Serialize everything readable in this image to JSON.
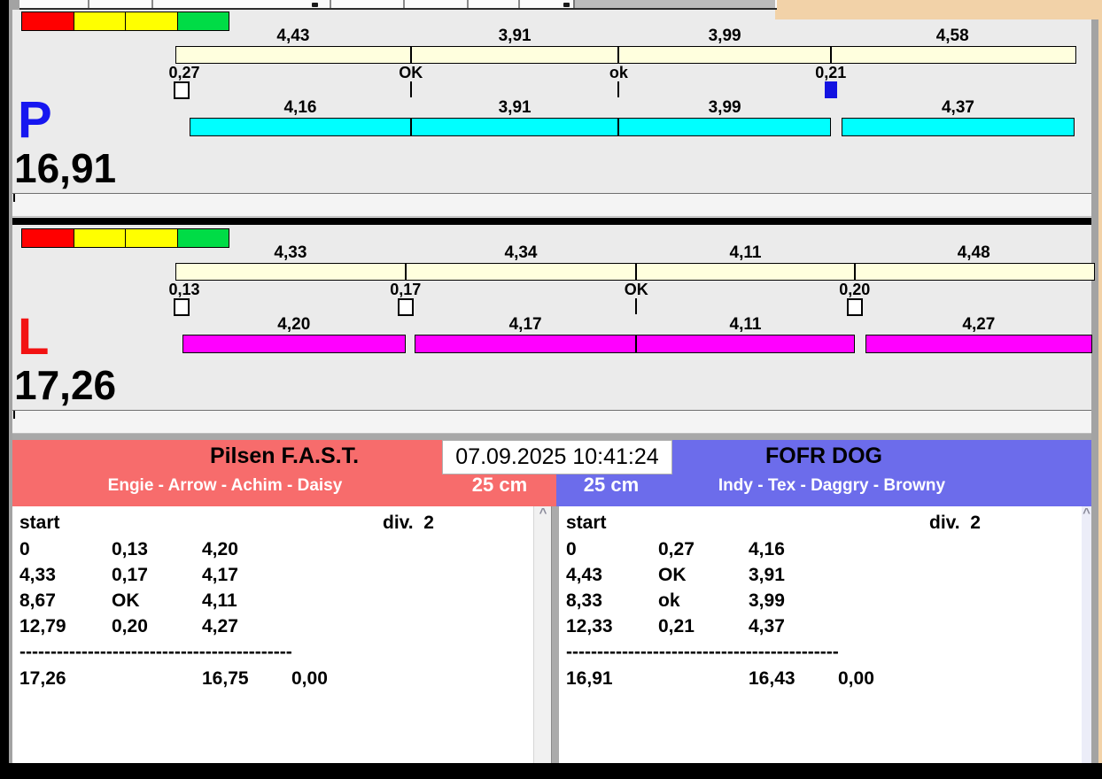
{
  "session": {
    "datetime": "07.09.2025 10:41:24"
  },
  "icons": {
    "scroll_up": "^"
  },
  "traffic_light_colors": [
    "#ff0000",
    "#ffff00",
    "#ffff00",
    "#00dc46"
  ],
  "colors": {
    "lane_right_bar": "#00ffff",
    "lane_left_bar": "#ff00ff",
    "split_bar": "#ffffde",
    "team_left_header": "#f76c6c",
    "team_right_header": "#6c6ceb",
    "letter_right": "#1616f0",
    "letter_left": "#f21212",
    "change_marker_blue": "#1313e1"
  },
  "lanes": [
    {
      "letter": "P",
      "letter_color": "#1616f0",
      "total": "16,91",
      "bar_color": "#00ffff",
      "splits": [
        "4,43",
        "3,91",
        "3,99",
        "4,58"
      ],
      "changes": [
        "0,27",
        "OK",
        "ok",
        "0,21"
      ],
      "markers": [
        "white",
        "tick",
        "tick",
        "blue"
      ],
      "dog_times": [
        "4,16",
        "3,91",
        "3,99",
        "4,37"
      ]
    },
    {
      "letter": "L",
      "letter_color": "#f21212",
      "total": "17,26",
      "bar_color": "#ff00ff",
      "splits": [
        "4,33",
        "4,34",
        "4,11",
        "4,48"
      ],
      "changes": [
        "0,13",
        "0,17",
        "OK",
        "0,20"
      ],
      "markers": [
        "white",
        "white",
        "tick",
        "white"
      ],
      "dog_times": [
        "4,20",
        "4,17",
        "4,11",
        "4,27"
      ]
    }
  ],
  "teams": [
    {
      "name": "Pilsen F.A.S.T.",
      "dogs": "Engie - Arrow - Achim - Daisy",
      "jump_height": "25 cm",
      "table": {
        "start_label": "start",
        "division": "div.  2",
        "rows": [
          [
            "0",
            "0,13",
            "4,20"
          ],
          [
            "4,33",
            "0,17",
            "4,17"
          ],
          [
            "8,67",
            "OK",
            "4,11"
          ],
          [
            "12,79",
            "0,20",
            "4,27"
          ]
        ],
        "separator": "--------------------------------------------",
        "totals": [
          "17,26",
          "16,75",
          "0,00"
        ]
      }
    },
    {
      "name": "FOFR DOG",
      "dogs": "Indy - Tex - Daggry - Browny",
      "jump_height": "25 cm",
      "table": {
        "start_label": "start",
        "division": "div.  2",
        "rows": [
          [
            "0",
            "0,27",
            "4,16"
          ],
          [
            "4,43",
            "OK",
            "3,91"
          ],
          [
            "8,33",
            "ok",
            "3,99"
          ],
          [
            "12,33",
            "0,21",
            "4,37"
          ]
        ],
        "separator": "--------------------------------------------",
        "totals": [
          "16,91",
          "16,43",
          "0,00"
        ]
      }
    }
  ]
}
